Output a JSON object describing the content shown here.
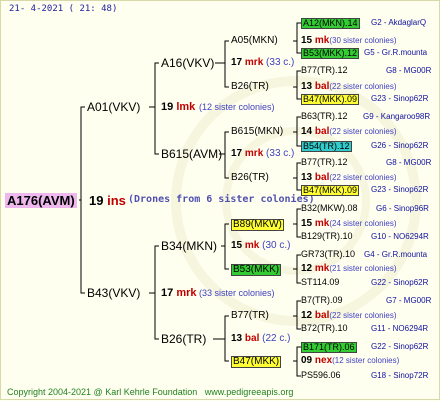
{
  "header": {
    "date": "21-   4-2021 (  21:  48)"
  },
  "footer": {
    "copyright": "Copyright 2004-2021 @ Karl Kehrle Foundation",
    "url": "www.pedigreeapis.org"
  },
  "root": {
    "label": "A176(AVM)",
    "number": "19",
    "suffix": "ins",
    "note": "(Drones from 6 sister colonies)"
  },
  "gen1": [
    {
      "label": "A01(VKV)",
      "number": "19",
      "suffix": "lmk",
      "note": "(12 sister colonies)"
    },
    {
      "label": "B43(VKV)",
      "number": "17",
      "suffix": "mrk",
      "note": "(33 sister colonies)"
    }
  ],
  "gen2": [
    {
      "label": "A16(VKV)",
      "number": "17",
      "suffix": "mrk",
      "note": "(33 c.)"
    },
    {
      "label": "B615(AVM)",
      "number": "17",
      "suffix": "mrk",
      "note": "(33 c.)"
    },
    {
      "label": "B34(MKN)",
      "number": "15",
      "suffix": "mk",
      "note": "(30 c.)"
    },
    {
      "label": "B26(TR)",
      "number": "13",
      "suffix": "bal",
      "note": "(22 c.)"
    }
  ],
  "gen3": [
    {
      "label": "A05(MKN)",
      "number": "15",
      "suffix": "mk",
      "note": "(30 sister colonies)"
    },
    {
      "label": "B26(TR)",
      "number": "13",
      "suffix": "bal",
      "note": "(22 sister colonies)"
    },
    {
      "label": "B615(MKN)",
      "number": "14",
      "suffix": "bal",
      "note": "(22 sister colonies)"
    },
    {
      "label": "B26(TR)",
      "number": "13",
      "suffix": "bal",
      "note": "(22 sister colonies)"
    },
    {
      "label": "B89(MKW)",
      "number": "15",
      "suffix": "mk",
      "note": "(24 sister colonies)"
    },
    {
      "label": "B53(MKK)",
      "number": "12",
      "suffix": "mk",
      "note": "(21 sister colonies)"
    },
    {
      "label": "B77(TR)",
      "number": "12",
      "suffix": "bal",
      "note": "(22 sister colonies)"
    },
    {
      "label": "B47(MKK)",
      "number": "09",
      "suffix": "nex",
      "note": "(12 sister colonies)"
    }
  ],
  "gen4": [
    {
      "label": "A12(MKN).14",
      "right": "G2 - AkdaglarQ"
    },
    {
      "label": "B53(MKK).12",
      "right": "G5 - Gr.R.mounta"
    },
    {
      "label": "B77(TR).12",
      "right": "G8 - MG00R"
    },
    {
      "label": "B47(MKK).09",
      "right": "G23 - Sinop62R"
    },
    {
      "label": "B63(TR).12",
      "right": "G9 - Kangaroo98R"
    },
    {
      "label": "B54(TR).12",
      "right": "G26 - Sinop62R"
    },
    {
      "label": "B77(TR).12",
      "right": "G8 - MG00R"
    },
    {
      "label": "B47(MKK).09",
      "right": "G23 - Sinop62R"
    },
    {
      "label": "B32(MKW).08",
      "right": "G6 - Sinop96R"
    },
    {
      "label": "B129(TR).10",
      "right": "G10 - NO6294R"
    },
    {
      "label": "GR73(TR).10",
      "right": "G4 - Gr.R.mounta"
    },
    {
      "label": "ST114.09",
      "right": "G22 - Sinop62R"
    },
    {
      "label": "B7(TR).09",
      "right": "G7 - MG00R"
    },
    {
      "label": "B72(TR).10",
      "right": "G11 - NO6294R"
    },
    {
      "label": "B171(TR).06",
      "right": "G22 - Sinop62R"
    },
    {
      "label": "PS596.06",
      "right": "G18 - Sinop72R"
    }
  ],
  "colors": {
    "green": "#33cc33",
    "yellow": "#ffff33",
    "cyan": "#33cccc",
    "root_bg": "#eeb8ee",
    "suffix": "#c00000",
    "note": "#4040c0"
  }
}
